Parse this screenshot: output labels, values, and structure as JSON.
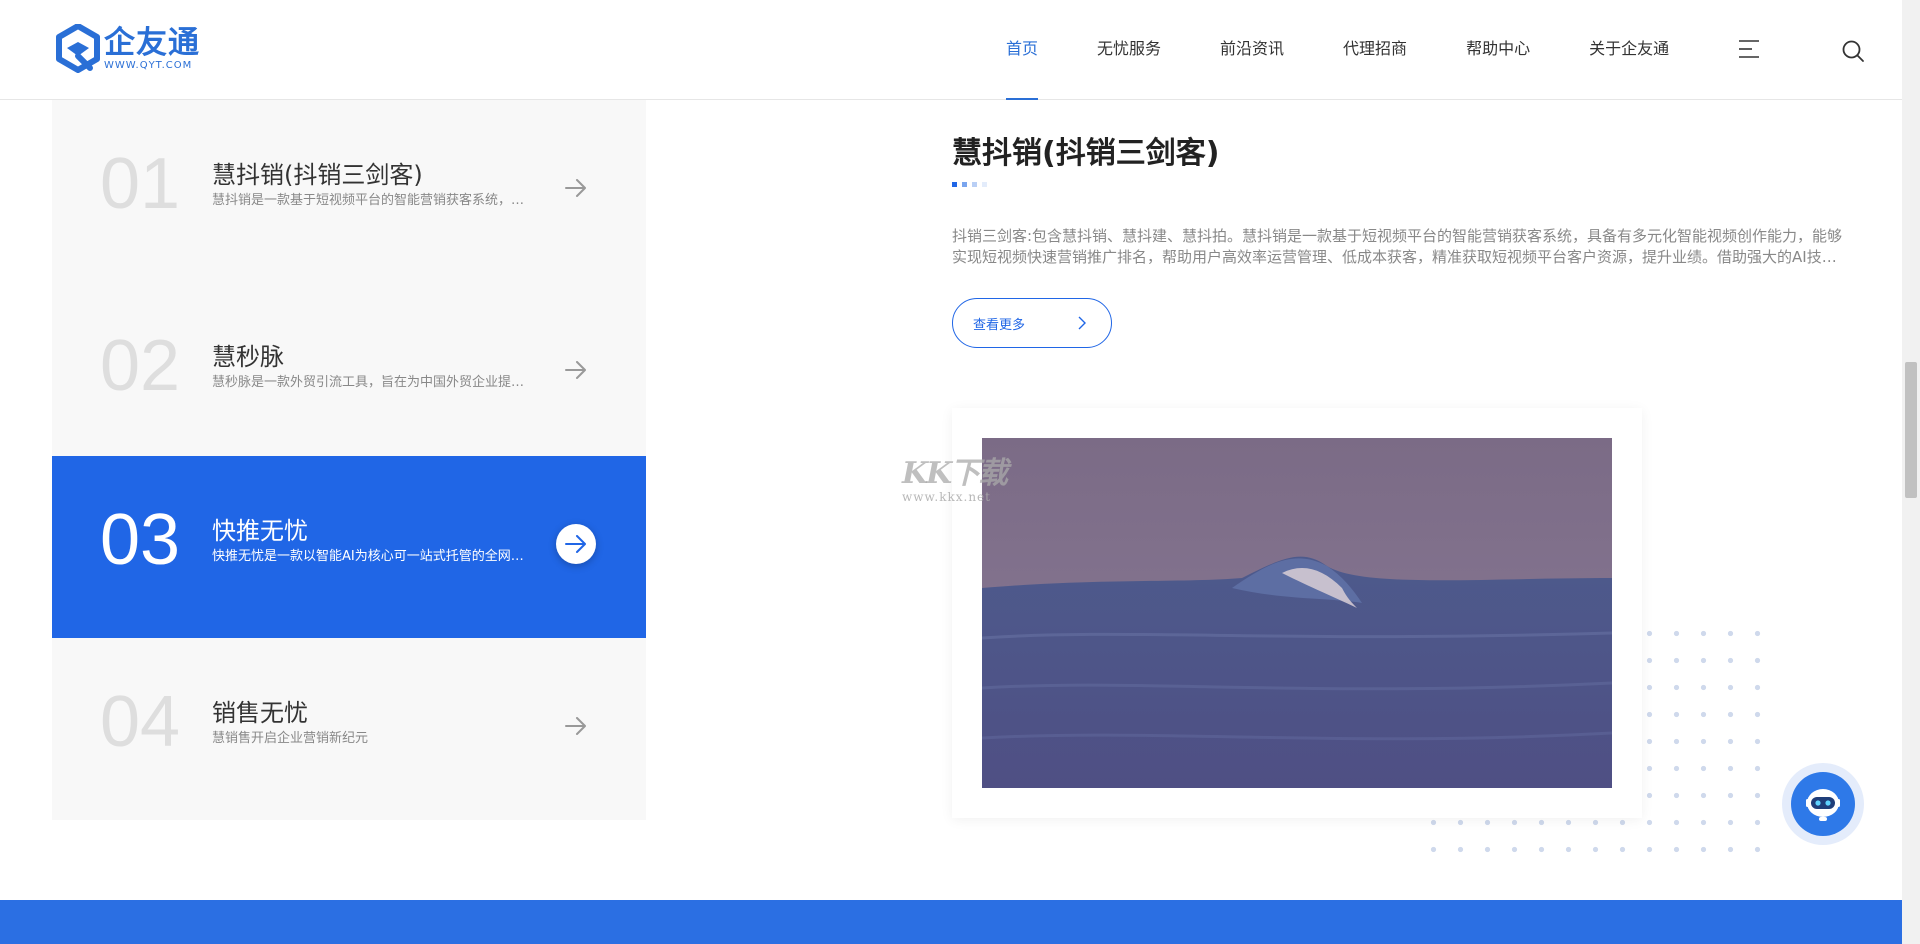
{
  "header": {
    "logo": {
      "name": "企友通",
      "url": "WWW.QYT.COM"
    },
    "nav": [
      {
        "label": "首页",
        "active": true
      },
      {
        "label": "无忧服务",
        "active": false
      },
      {
        "label": "前沿资讯",
        "active": false
      },
      {
        "label": "代理招商",
        "active": false
      },
      {
        "label": "帮助中心",
        "active": false
      },
      {
        "label": "关于企友通",
        "active": false
      }
    ],
    "icons": [
      "menu-icon",
      "search-icon"
    ]
  },
  "products": [
    {
      "num": "01",
      "title": "慧抖销(抖销三剑客)",
      "desc": "慧抖销是一款基于短视频平台的智能营销获客系统，具备有多元化智能视频创作能力",
      "active": false
    },
    {
      "num": "02",
      "title": "慧秒脉",
      "desc": "慧秒脉是一款外贸引流工具，旨在为中国外贸企业提供精准获客服务",
      "active": false
    },
    {
      "num": "03",
      "title": "快推无忧",
      "desc": "快推无忧是一款以智能AI为核心可一站式托管的全网营销推广平台",
      "active": true
    },
    {
      "num": "04",
      "title": "销售无忧",
      "desc": "慧销售开启企业营销新纪元",
      "active": false
    }
  ],
  "detail": {
    "title": "慧抖销(抖销三剑客)",
    "desc": "抖销三剑客:包含慧抖销、慧抖建、慧抖拍。慧抖销是一款基于短视频平台的智能营销获客系统，具备有多元化智能视频创作能力，能够实现短视频快速营销推广排名，帮助用户高效率运营管理、低成本获客，精准获取短视频平台客户资源，提升业绩。借助强大的AI技术赋能企业营销。",
    "more_label": "查看更多"
  },
  "watermark": {
    "main": "KK下载",
    "url": "www.kkx.net"
  },
  "colors": {
    "brand": "#2066e6",
    "accent": "#2a6fd6",
    "footer": "#2b6fe3"
  }
}
